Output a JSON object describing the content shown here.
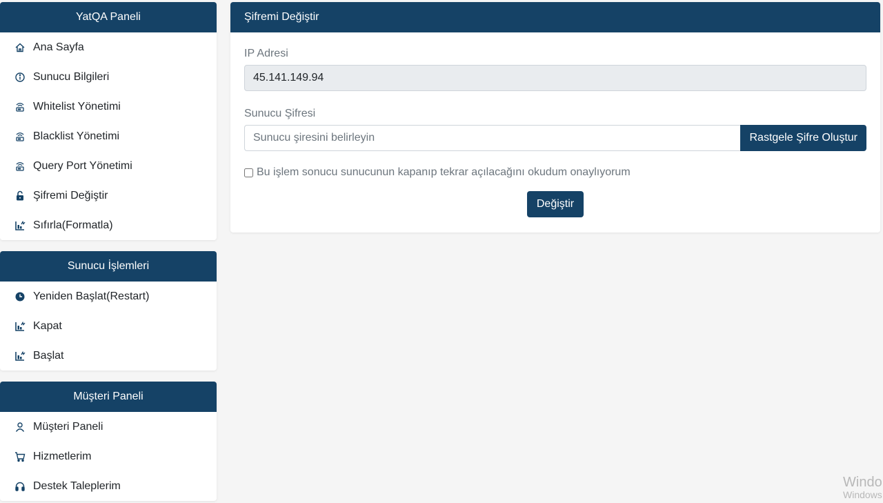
{
  "sidebar": {
    "panels": [
      {
        "title": "YatQA Paneli",
        "items": [
          {
            "label": "Ana Sayfa",
            "icon": "home-icon"
          },
          {
            "label": "Sunucu Bilgileri",
            "icon": "info-circle-icon"
          },
          {
            "label": "Whitelist Yönetimi",
            "icon": "router-icon"
          },
          {
            "label": "Blacklist Yönetimi",
            "icon": "router-icon"
          },
          {
            "label": "Query Port Yönetimi",
            "icon": "router-icon"
          },
          {
            "label": "Şifremi Değiştir",
            "icon": "unlock-icon"
          },
          {
            "label": "Sıfırla(Formatla)",
            "icon": "activity-chart-icon"
          }
        ]
      },
      {
        "title": "Sunucu İşlemleri",
        "items": [
          {
            "label": "Yeniden Başlat(Restart)",
            "icon": "clock-icon"
          },
          {
            "label": "Kapat",
            "icon": "activity-chart-icon"
          },
          {
            "label": "Başlat",
            "icon": "activity-chart-icon"
          }
        ]
      },
      {
        "title": "Müşteri Paneli",
        "items": [
          {
            "label": "Müşteri Paneli",
            "icon": "user-icon"
          },
          {
            "label": "Hizmetlerim",
            "icon": "cart-icon"
          },
          {
            "label": "Destek Taleplerim",
            "icon": "headset-icon"
          }
        ]
      }
    ]
  },
  "main": {
    "title": "Şifremi Değiştir",
    "ip_label": "IP Adresi",
    "ip_value": "45.141.149.94",
    "password_label": "Sunucu Şifresi",
    "password_placeholder": "Sunucu şiresini belirleyin",
    "password_value": "",
    "generate_button": "Rastgele Şifre Oluştur",
    "confirm_checkbox_label": "Bu işlem sonucu sunucunun kapanıp tekrar açılacağını okudum onaylıyorum",
    "confirm_checked": false,
    "submit_button": "Değiştir"
  },
  "watermark": {
    "line1": "Windo",
    "line2": "Windows"
  },
  "colors": {
    "primary": "#154266",
    "background": "#f5f5f5",
    "readonly_bg": "#e9ecef"
  }
}
